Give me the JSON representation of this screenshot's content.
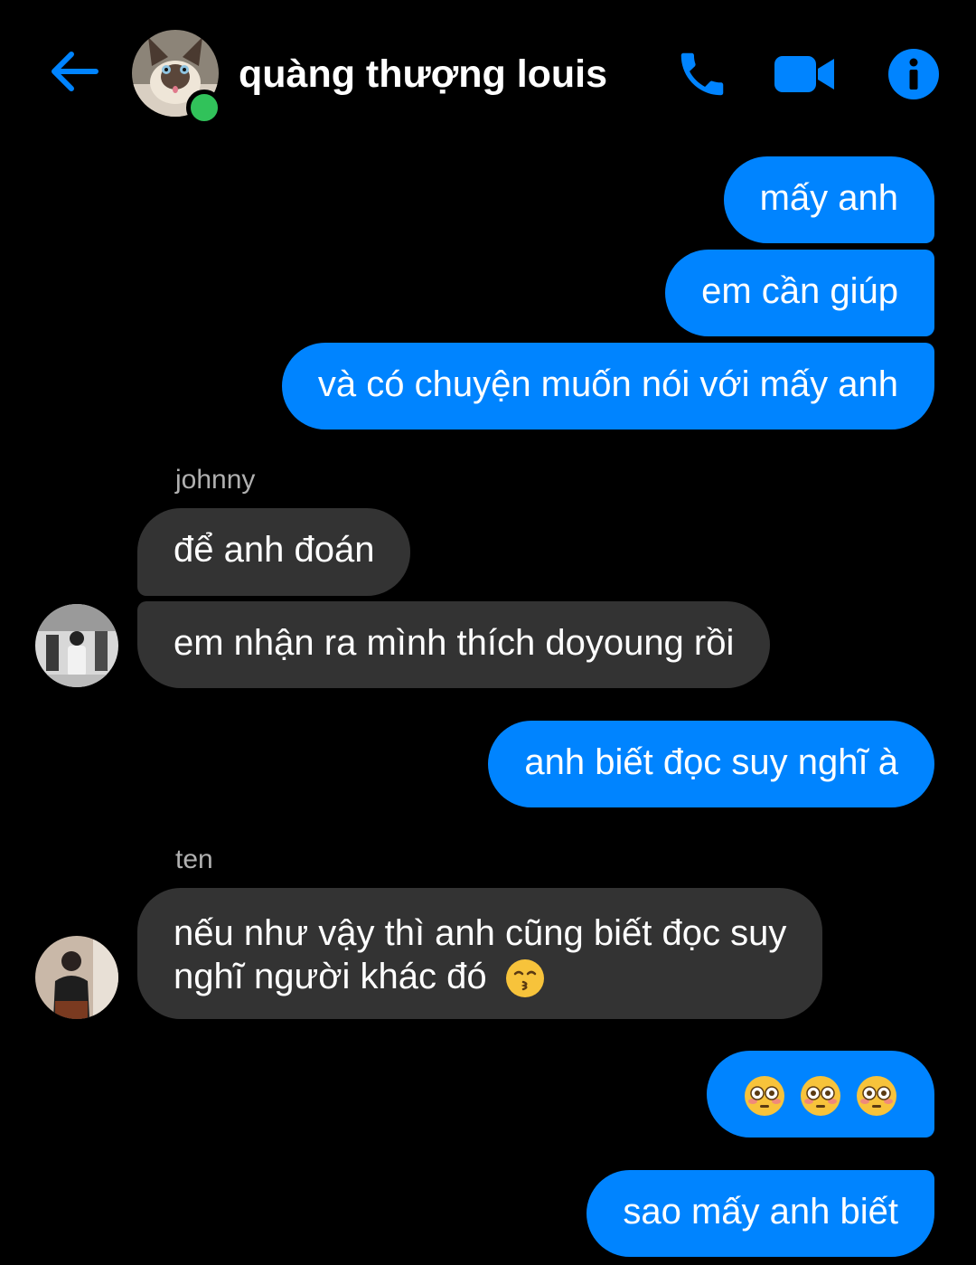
{
  "header": {
    "contact_name": "quàng thượng louis",
    "accent_color": "#0084ff",
    "online_color": "#31c25a",
    "icons": [
      "back-arrow-icon",
      "phone-icon",
      "video-camera-icon",
      "info-icon"
    ]
  },
  "conversation": {
    "messages": [
      {
        "from": "me",
        "text": "mấy anh"
      },
      {
        "from": "me",
        "text": "em cần giúp"
      },
      {
        "from": "me",
        "text": "và có chuyện muốn nói với mấy anh"
      },
      {
        "from": "johnny",
        "sender_label": "johnny",
        "text": "để anh đoán"
      },
      {
        "from": "johnny",
        "text": "em nhận ra mình thích doyoung rồi"
      },
      {
        "from": "me",
        "text": "anh biết đọc suy nghĩ à"
      },
      {
        "from": "ten",
        "sender_label": "ten",
        "text_line1": "nếu như vậy thì anh cũng biết đọc suy",
        "text_line2": "nghĩ người khác đó",
        "emoji": "kissing-face-emoji"
      },
      {
        "from": "me",
        "emoji": "flushed-face-emoji",
        "emoji_count": 3
      },
      {
        "from": "me",
        "text": "sao mấy anh biết"
      }
    ]
  }
}
